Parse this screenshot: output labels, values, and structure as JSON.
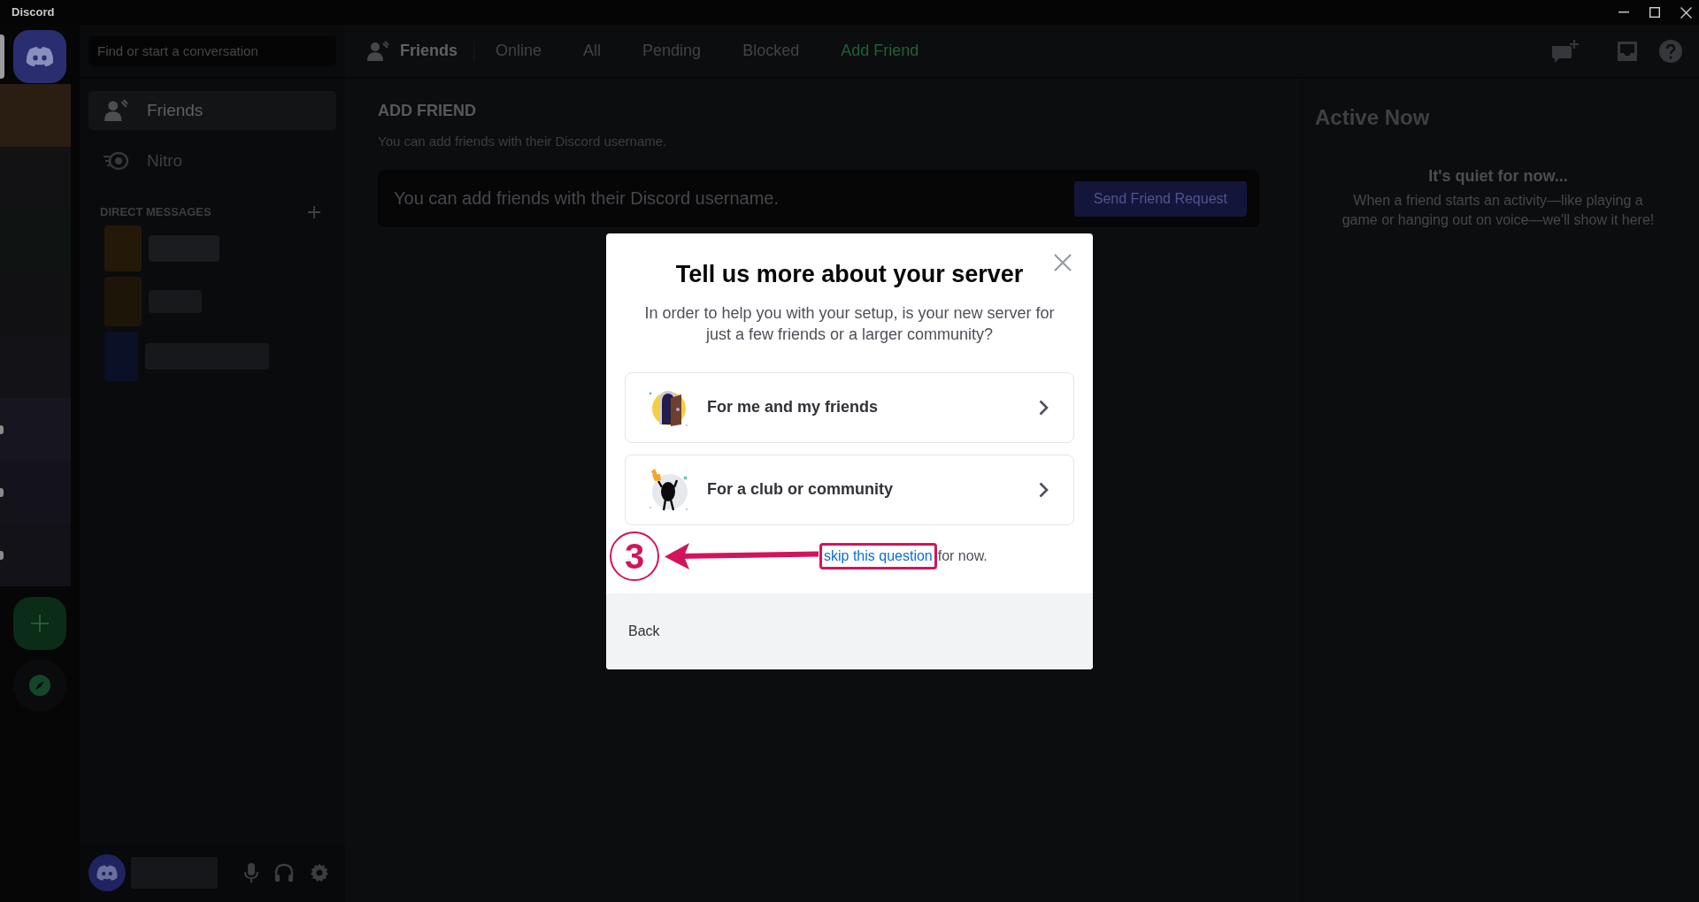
{
  "window": {
    "title": "Discord"
  },
  "server_rail": {
    "home": {
      "selected": true
    },
    "servers": [
      {
        "unread": false
      },
      {
        "unread": false
      },
      {
        "unread": false
      },
      {
        "unread": false
      },
      {
        "unread": false
      },
      {
        "unread": true
      },
      {
        "unread": true
      },
      {
        "unread": true
      }
    ]
  },
  "sidebar": {
    "search": {
      "placeholder": "Find or start a conversation"
    },
    "items": [
      {
        "label": "Friends",
        "kind": "friends",
        "selected": true
      },
      {
        "label": "Nitro",
        "kind": "nitro",
        "selected": false
      }
    ],
    "direct_messages": {
      "title": "DIRECT MESSAGES"
    }
  },
  "header": {
    "title": "Friends",
    "tabs": [
      {
        "label": "Online",
        "kind": "tab",
        "selected": false
      },
      {
        "label": "All",
        "kind": "tab",
        "selected": false
      },
      {
        "label": "Pending",
        "kind": "tab",
        "selected": false
      },
      {
        "label": "Blocked",
        "kind": "tab",
        "selected": false
      },
      {
        "label": "Add Friend",
        "kind": "add",
        "selected": true
      }
    ]
  },
  "add_friend": {
    "title": "ADD FRIEND",
    "description": "You can add friends with their Discord username.",
    "input": {
      "placeholder": "You can add friends with their Discord username."
    },
    "button": {
      "label": "Send Friend Request",
      "disabled": true
    }
  },
  "active_now": {
    "title": "Active Now",
    "empty_title": "It's quiet for now...",
    "empty_text": "When a friend starts an activity—like playing a game or hanging out on voice—we'll show it here!"
  },
  "modal": {
    "title": "Tell us more about your server",
    "description": "In order to help you with your setup, is your new server for just a few friends or a larger community?",
    "options": [
      {
        "label": "For me and my friends",
        "kind": "friends"
      },
      {
        "label": "For a club or community",
        "kind": "community"
      }
    ],
    "hint": {
      "link": "skip this question",
      "after": "for now."
    },
    "back": "Back"
  },
  "annotation": {
    "step": "3"
  }
}
